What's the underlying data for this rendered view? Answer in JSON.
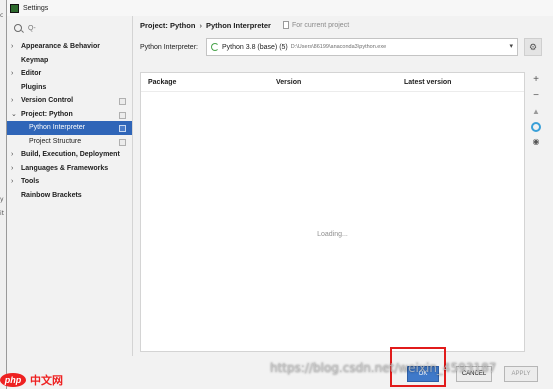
{
  "window": {
    "title": "Settings"
  },
  "editor_strip": {
    "markers": [
      "c",
      "y",
      "it"
    ]
  },
  "sidebar": {
    "search_placeholder": "Q-",
    "items": [
      {
        "label": "Appearance & Behavior",
        "arrow": "›",
        "level": 0
      },
      {
        "label": "Keymap",
        "arrow": "",
        "level": 0
      },
      {
        "label": "Editor",
        "arrow": "›",
        "level": 0
      },
      {
        "label": "Plugins",
        "arrow": "",
        "level": 0
      },
      {
        "label": "Version Control",
        "arrow": "›",
        "level": 0
      },
      {
        "label": "Project: Python",
        "arrow": "⌄",
        "level": 0
      },
      {
        "label": "Python Interpreter",
        "arrow": "",
        "level": 1,
        "selected": true
      },
      {
        "label": "Project Structure",
        "arrow": "",
        "level": 1
      },
      {
        "label": "Build, Execution, Deployment",
        "arrow": "›",
        "level": 0
      },
      {
        "label": "Languages & Frameworks",
        "arrow": "›",
        "level": 0
      },
      {
        "label": "Tools",
        "arrow": "›",
        "level": 0
      },
      {
        "label": "Rainbow Brackets",
        "arrow": "",
        "level": 0
      }
    ]
  },
  "breadcrumb": {
    "project": "Project: Python",
    "separator": "›",
    "page": "Python Interpreter",
    "hint": "For current project"
  },
  "interpreter": {
    "label": "Python Interpreter:",
    "name": "Python 3.8 (base) (5)",
    "path": "D:\\Users\\86199\\anaconda3\\python.exe"
  },
  "packages_table": {
    "columns": [
      "Package",
      "Version",
      "Latest version"
    ],
    "status": "Loading..."
  },
  "footer": {
    "ok_label": "OK",
    "cancel_label": "CANCEL",
    "apply_label": "APPLY"
  },
  "watermark": {
    "url": "https://blog.csdn.net/weixin_4593187",
    "logo_badge": "php",
    "logo_text": "中文网"
  },
  "colors": {
    "selection": "#2f65b8",
    "highlight_box": "#e11b1b",
    "ok_button": "#3f79c9"
  }
}
